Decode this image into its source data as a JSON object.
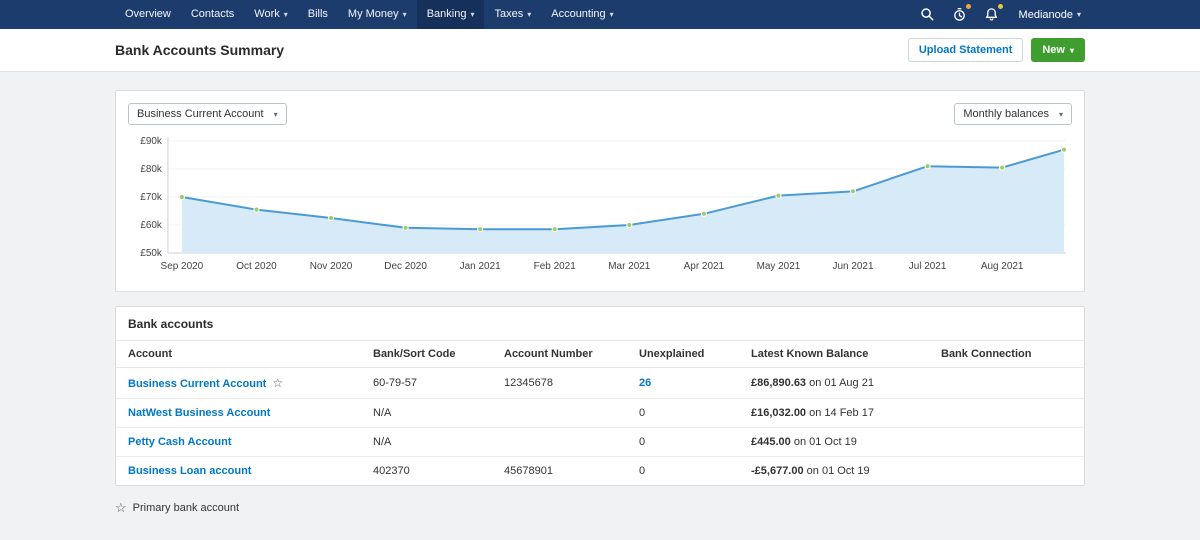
{
  "colors": {
    "navbar_bg": "#1d3c6e",
    "navbar_active_bg": "#15305a",
    "link_blue": "#0077c8",
    "green_button": "#3f9e2f",
    "chart_line": "#4a9ad4",
    "chart_fill": "#d7eaf8",
    "chart_marker": "#a0cc68",
    "badge_orange": "#f0a63c",
    "badge_yellow": "#e4c93f"
  },
  "navbar": {
    "items": [
      {
        "label": "Overview",
        "dropdown": false,
        "active": false
      },
      {
        "label": "Contacts",
        "dropdown": false,
        "active": false
      },
      {
        "label": "Work",
        "dropdown": true,
        "active": false
      },
      {
        "label": "Bills",
        "dropdown": false,
        "active": false
      },
      {
        "label": "My Money",
        "dropdown": true,
        "active": false
      },
      {
        "label": "Banking",
        "dropdown": true,
        "active": true
      },
      {
        "label": "Taxes",
        "dropdown": true,
        "active": false
      },
      {
        "label": "Accounting",
        "dropdown": true,
        "active": false
      }
    ],
    "user": {
      "label": "Medianode",
      "dropdown": true
    }
  },
  "header": {
    "title": "Bank Accounts Summary",
    "upload_button": "Upload Statement",
    "new_button": "New"
  },
  "filters": {
    "account": "Business Current Account",
    "period": "Monthly balances"
  },
  "chart_data": {
    "type": "area",
    "title": "Business Current Account monthly balances",
    "categories": [
      "Sep 2020",
      "Oct 2020",
      "Nov 2020",
      "Dec 2020",
      "Jan 2021",
      "Feb 2021",
      "Mar 2021",
      "Apr 2021",
      "May 2021",
      "Jun 2021",
      "Jul 2021",
      "Aug 2021"
    ],
    "values": [
      70,
      65.5,
      62.5,
      59,
      58.5,
      58.5,
      60,
      64,
      70.5,
      72,
      81,
      80.5
    ],
    "end_value": 86.9,
    "ylim": [
      50,
      90
    ],
    "yticks": [
      50,
      60,
      70,
      80,
      90
    ],
    "ytick_format": "£{v}k",
    "grid": true,
    "legend_position": "none"
  },
  "accounts": {
    "title": "Bank accounts",
    "columns": [
      "Account",
      "Bank/Sort Code",
      "Account Number",
      "Unexplained",
      "Latest Known Balance",
      "Bank Connection"
    ],
    "rows": [
      {
        "account": "Business Current Account",
        "primary": true,
        "sort_code": "60-79-57",
        "account_number": "12345678",
        "unexplained": "26",
        "unexplained_is_link": true,
        "balance": "£86,890.63",
        "balance_date": "on 01 Aug 21",
        "connection": ""
      },
      {
        "account": "NatWest Business Account",
        "primary": false,
        "sort_code": "N/A",
        "account_number": "",
        "unexplained": "0",
        "unexplained_is_link": false,
        "balance": "£16,032.00",
        "balance_date": "on 14 Feb 17",
        "connection": ""
      },
      {
        "account": "Petty Cash Account",
        "primary": false,
        "sort_code": "N/A",
        "account_number": "",
        "unexplained": "0",
        "unexplained_is_link": false,
        "balance": "£445.00",
        "balance_date": "on 01 Oct 19",
        "connection": ""
      },
      {
        "account": "Business Loan account",
        "primary": false,
        "sort_code": "402370",
        "account_number": "45678901",
        "unexplained": "0",
        "unexplained_is_link": false,
        "balance": "-£5,677.00",
        "balance_date": "on 01 Oct 19",
        "connection": ""
      }
    ],
    "legend": "Primary bank account",
    "legend_icon": "☆"
  }
}
